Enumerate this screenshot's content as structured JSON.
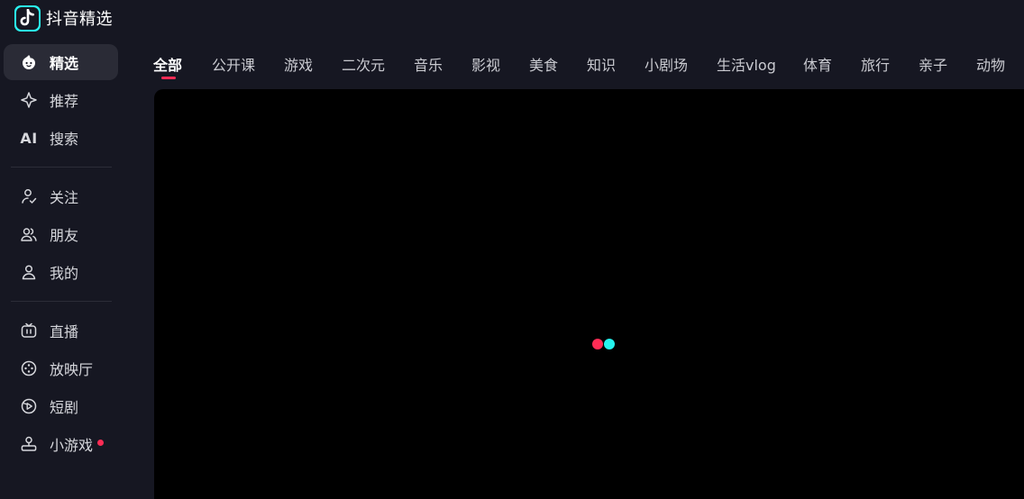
{
  "app": {
    "title": "抖音精选"
  },
  "sidebar": {
    "groups": [
      [
        {
          "label": "精选",
          "icon": "jingxuan-icon",
          "active": true
        },
        {
          "label": "推荐",
          "icon": "sparkle-icon"
        },
        {
          "label": "搜索",
          "icon": "ai-icon",
          "icon_text": "AI"
        }
      ],
      [
        {
          "label": "关注",
          "icon": "follow-icon"
        },
        {
          "label": "朋友",
          "icon": "friends-icon"
        },
        {
          "label": "我的",
          "icon": "profile-icon"
        }
      ],
      [
        {
          "label": "直播",
          "icon": "live-tv-icon"
        },
        {
          "label": "放映厅",
          "icon": "film-reel-icon"
        },
        {
          "label": "短剧",
          "icon": "short-drama-icon"
        },
        {
          "label": "小游戏",
          "icon": "mini-game-icon",
          "badge_dot": true
        }
      ]
    ]
  },
  "tabs": [
    {
      "label": "全部",
      "active": true
    },
    {
      "label": "公开课"
    },
    {
      "label": "游戏"
    },
    {
      "label": "二次元"
    },
    {
      "label": "音乐"
    },
    {
      "label": "影视"
    },
    {
      "label": "美食"
    },
    {
      "label": "知识"
    },
    {
      "label": "小剧场"
    },
    {
      "label": "生活vlog"
    },
    {
      "label": "体育"
    },
    {
      "label": "旅行"
    },
    {
      "label": "亲子"
    },
    {
      "label": "动物"
    }
  ],
  "colors": {
    "accent_red": "#fe2c55",
    "accent_cyan": "#25f4ee",
    "background": "#161722",
    "player_bg": "#000000"
  }
}
